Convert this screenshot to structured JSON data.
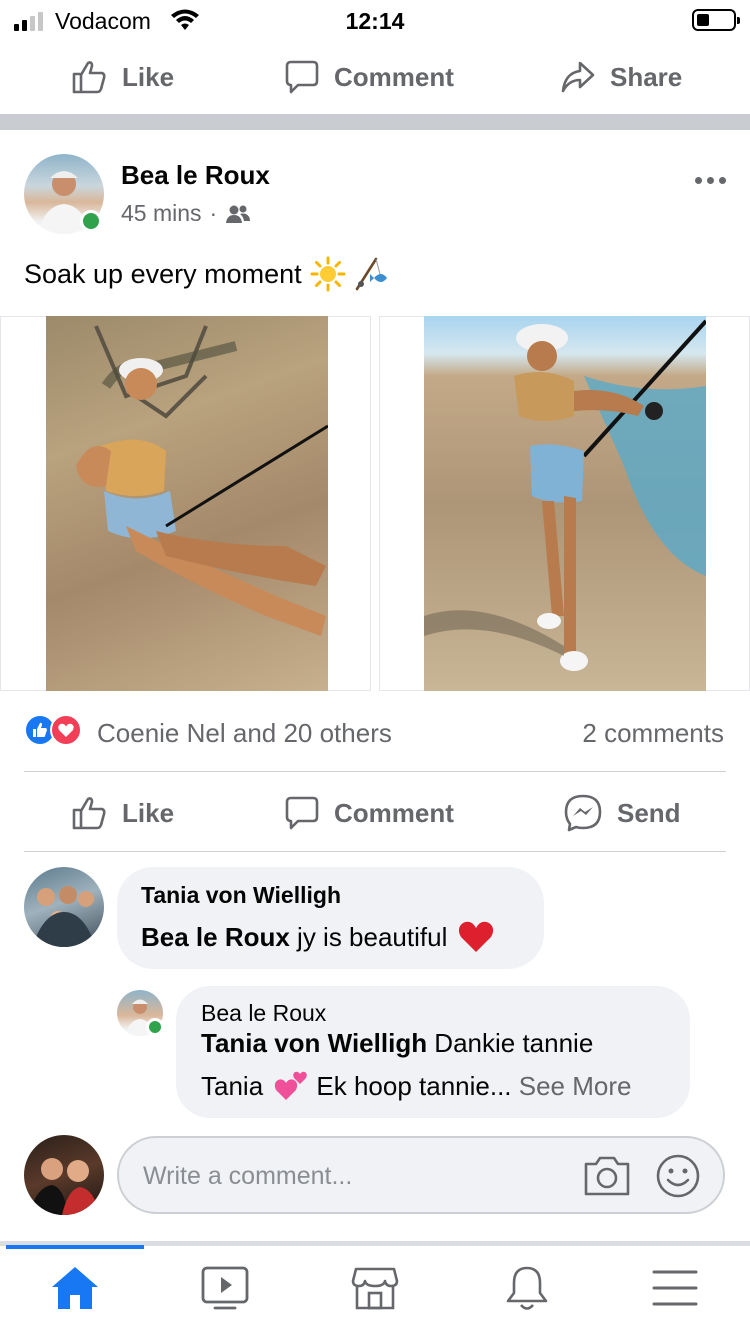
{
  "status_bar": {
    "carrier": "Vodacom",
    "time": "12:14",
    "battery_level": 0.35
  },
  "top_actions": {
    "like": "Like",
    "comment": "Comment",
    "share": "Share"
  },
  "post": {
    "author": "Bea le Roux",
    "time": "45 mins",
    "meta_separator": "·",
    "caption": "Soak up every moment",
    "reactions_text": "Coenie Nel and 20 others",
    "comments_count": "2 comments",
    "actions": {
      "like": "Like",
      "comment": "Comment",
      "send": "Send"
    }
  },
  "comments": [
    {
      "name": "Tania von Wielligh",
      "mention": "Bea le Roux",
      "text": " jy is beautiful"
    },
    {
      "name": "Bea le Roux",
      "mention": "Tania von Wielligh",
      "text_line1": " Dankie tannie",
      "text_line2": "Tania",
      "text_line3": " Ek hoop tannie...",
      "see_more": " See More"
    }
  ],
  "comment_input": {
    "placeholder": "Write a comment..."
  },
  "colors": {
    "accent": "#1877f2",
    "online": "#31a24c",
    "secondary_text": "#65676b",
    "love": "#f33e58"
  },
  "icons": [
    "like-icon",
    "comment-icon",
    "share-icon",
    "messenger-icon",
    "camera-icon",
    "emoji-icon",
    "home-icon",
    "watch-icon",
    "marketplace-icon",
    "bell-icon",
    "menu-icon"
  ]
}
